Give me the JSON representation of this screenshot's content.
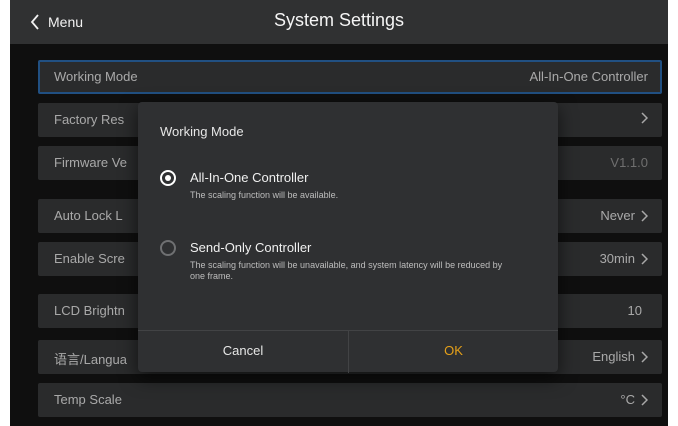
{
  "header": {
    "back_label": "Menu",
    "title": "System Settings"
  },
  "settings": [
    {
      "label": "Working Mode",
      "value": "All-In-One Controller"
    },
    {
      "label": "Factory Res",
      "value": ""
    },
    {
      "label": "Firmware Ve",
      "value": "V1.1.0"
    },
    {
      "label": "Auto Lock L",
      "value": "Never"
    },
    {
      "label": "Enable Scre",
      "value": "30min"
    },
    {
      "label": "LCD Brightn",
      "value": "10"
    },
    {
      "label": "语言/Langua",
      "value": "English"
    },
    {
      "label": "Temp Scale",
      "value": "°C"
    }
  ],
  "dialog": {
    "title": "Working Mode",
    "options": [
      {
        "label": "All-In-One Controller",
        "description": "The scaling function will be available.",
        "selected": true
      },
      {
        "label": "Send-Only Controller",
        "description": "The scaling function will be unavailable, and system latency will be reduced by one frame.",
        "selected": false
      }
    ],
    "cancel_label": "Cancel",
    "ok_label": "OK"
  },
  "colors": {
    "accent": "#e5a019",
    "focus": "#2f6fb4",
    "background": "#161616",
    "row": "#3b3c3e"
  }
}
